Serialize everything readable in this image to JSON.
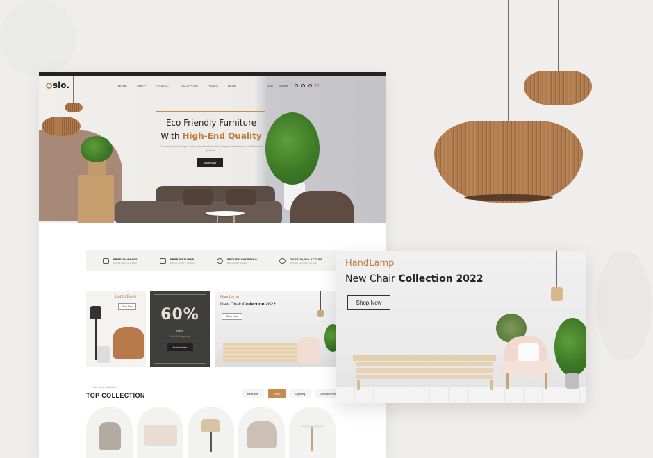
{
  "site": {
    "logo_suffix": "slo.",
    "nav": [
      "HOME",
      "SHOP",
      "PRODUCT",
      "OSLO PLUS",
      "PAGES",
      "BLOG"
    ],
    "currency": "USD",
    "language": "English",
    "hero": {
      "title_line1": "Eco Friendly Furniture",
      "title_line2_prefix": "With ",
      "title_line2_highlight": "High-End Quality",
      "text": "The best furniture designer created eco-friendly furniture for your dreams house, visit all creative products",
      "button": "Shop Now"
    },
    "features": [
      {
        "title": "FREE SHIPPING",
        "sub": "Free all orders over $100",
        "icon": "truck-icon"
      },
      {
        "title": "FREE RETURNS",
        "sub": "Back to us with in 30 days",
        "icon": "box-icon"
      },
      {
        "title": "SECURE SHOPPING",
        "sub": "Best security features",
        "icon": "shield-icon"
      },
      {
        "title": "OVER 10,000 STYLES",
        "sub": "We have everything you need",
        "icon": "tag-icon"
      }
    ],
    "promos": {
      "p1": {
        "title": "Lamp Desk",
        "button": "Shop Now"
      },
      "p2": {
        "percent": "60%",
        "line1": "Interior",
        "line2": "Sale Of Everything",
        "button": "Explore Here"
      },
      "p3": {
        "kicker": "HandLamp",
        "title_prefix": "New Chair ",
        "title_bold": "Collection 2022",
        "button": "Shop Now"
      }
    },
    "collection": {
      "kicker": "Our Best Collection",
      "title": "TOP COLLECTION",
      "tabs": [
        "Bedroom",
        "Deck",
        "Lighting",
        "Accessories"
      ],
      "active_tab": "Deck"
    }
  },
  "card": {
    "kicker": "HandLamp",
    "title_prefix": "New Chair ",
    "title_bold": "Collection 2022",
    "button": "Shop Now"
  },
  "colors": {
    "accent": "#c07a3c",
    "dark": "#222222",
    "background": "#efeeec"
  }
}
